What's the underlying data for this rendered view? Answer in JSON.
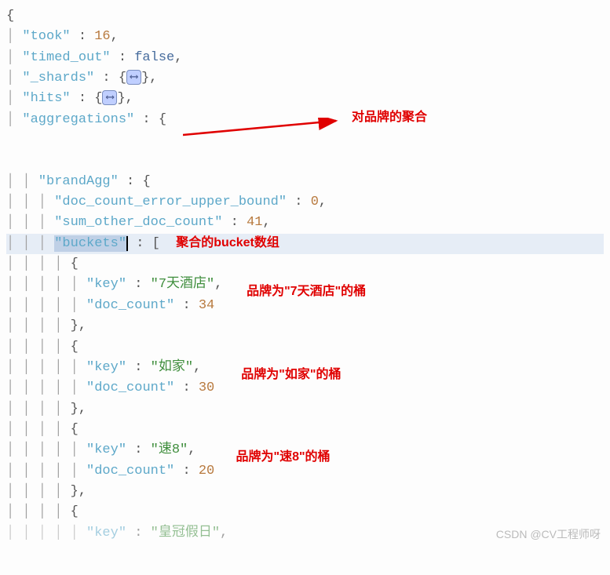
{
  "json": {
    "took_key": "\"took\"",
    "took_val": "16",
    "timed_out_key": "\"timed_out\"",
    "timed_out_val": "false",
    "shards_key": "\"_shards\"",
    "hits_key": "\"hits\"",
    "aggs_key": "\"aggregations\"",
    "brandAgg_key": "\"brandAgg\"",
    "doc_err_key": "\"doc_count_error_upper_bound\"",
    "doc_err_val": "0",
    "sum_other_key": "\"sum_other_doc_count\"",
    "sum_other_val": "41",
    "buckets_key": "\"buckets\"",
    "key_label": "\"key\"",
    "doc_count_label": "\"doc_count\"",
    "bucket1_key": "\"7天酒店\"",
    "bucket1_count": "34",
    "bucket2_key": "\"如家\"",
    "bucket2_count": "30",
    "bucket3_key": "\"速8\"",
    "bucket3_count": "20",
    "tail_key_label": "\"key\"",
    "tail_val_partial": "\"皇冠假日\""
  },
  "annotations": {
    "agg_label": "对品牌的聚合",
    "bucket_array": "聚合的bucket数组",
    "bucket1": "品牌为\"7天酒店\"的桶",
    "bucket2": "品牌为\"如家\"的桶",
    "bucket3": "品牌为\"速8\"的桶"
  },
  "fold_glyph": "⟷",
  "watermark": "CSDN @CV工程师呀"
}
